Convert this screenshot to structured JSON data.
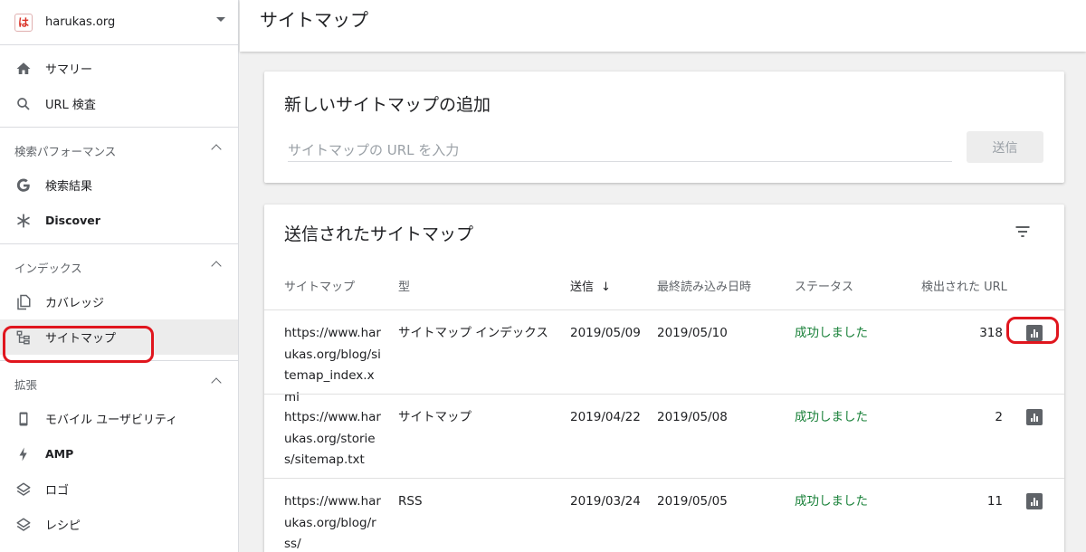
{
  "property": {
    "logo_text": "は",
    "name": "harukas.org"
  },
  "nav": {
    "top": [
      {
        "label": "サマリー",
        "icon": "home-icon"
      },
      {
        "label": "URL 検査",
        "icon": "search-icon"
      }
    ],
    "sections": [
      {
        "title": "検索パフォーマンス",
        "items": [
          {
            "label": "検索結果",
            "icon": "google-g-icon"
          },
          {
            "label": "Discover",
            "icon": "asterisk-icon"
          }
        ]
      },
      {
        "title": "インデックス",
        "items": [
          {
            "label": "カバレッジ",
            "icon": "copy-icon"
          },
          {
            "label": "サイトマップ",
            "icon": "sitemap-icon",
            "active": true
          }
        ]
      },
      {
        "title": "拡張",
        "items": [
          {
            "label": "モバイル ユーザビリティ",
            "icon": "phone-icon"
          },
          {
            "label": "AMP",
            "icon": "bolt-icon"
          },
          {
            "label": "ロゴ",
            "icon": "layers-icon"
          },
          {
            "label": "レシピ",
            "icon": "layers-icon"
          }
        ]
      }
    ]
  },
  "header": {
    "title": "サイトマップ"
  },
  "add_card": {
    "title": "新しいサイトマップの追加",
    "input_placeholder": "サイトマップの URL を入力",
    "submit_label": "送信"
  },
  "list_card": {
    "title": "送信されたサイトマップ",
    "columns": [
      "サイトマップ",
      "型",
      "送信",
      "最終読み込み日時",
      "ステータス",
      "検出された URL"
    ],
    "sort_arrow": "↓",
    "rows": [
      {
        "url": "https://www.harukas.org/blog/sitemap_index.xml",
        "type": "サイトマップ インデックス",
        "submitted": "2019/05/09",
        "last_read": "2019/05/10",
        "status": "成功しました",
        "count": "318"
      },
      {
        "url": "https://www.harukas.org/stories/sitemap.txt",
        "type": "サイトマップ",
        "submitted": "2019/04/22",
        "last_read": "2019/05/08",
        "status": "成功しました",
        "count": "2"
      },
      {
        "url": "https://www.harukas.org/blog/rss/",
        "type": "RSS",
        "submitted": "2019/03/24",
        "last_read": "2019/05/05",
        "status": "成功しました",
        "count": "11"
      }
    ]
  },
  "colors": {
    "success": "#188038",
    "highlight": "#e0161e",
    "active_bg": "#ececec"
  }
}
